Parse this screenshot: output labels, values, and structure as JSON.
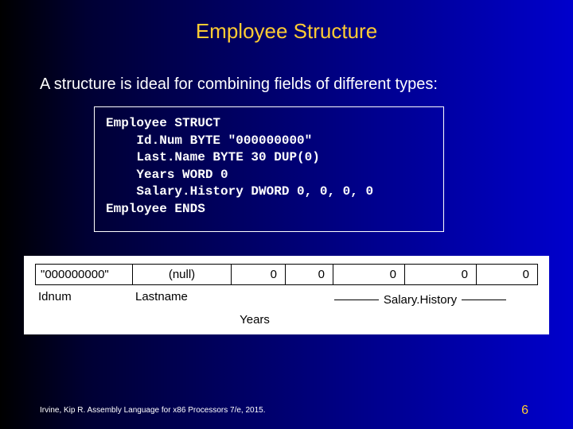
{
  "title": "Employee Structure",
  "intro": "A structure is ideal for combining fields of different types:",
  "code": {
    "l1": "Employee STRUCT",
    "l2": "    Id.Num BYTE \"000000000\"",
    "l3": "    Last.Name BYTE 30 DUP(0)",
    "l4": "    Years WORD 0",
    "l5": "    Salary.History DWORD 0, 0, 0, 0",
    "l6": "Employee ENDS"
  },
  "diagram": {
    "cells": {
      "c1": "\"000000000\"",
      "c2": "(null)",
      "c3": "0",
      "c4": "0",
      "c5": "0",
      "c6": "0",
      "c7": "0"
    },
    "labels": {
      "idnum": "Idnum",
      "lastname": "Lastname",
      "salaryhistory": "Salary.History",
      "years": "Years"
    }
  },
  "footer": "Irvine, Kip R. Assembly Language for x86 Processors 7/e, 2015.",
  "pagenum": "6"
}
